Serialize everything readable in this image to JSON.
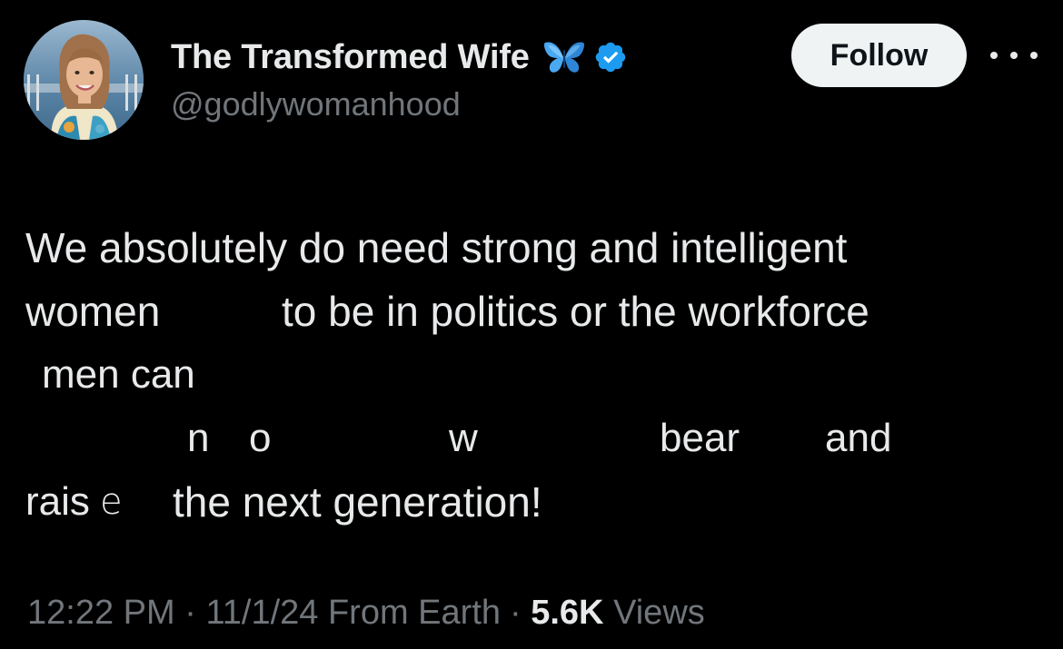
{
  "author": {
    "display_name": "The Transformed Wife",
    "handle": "@godlywomanhood",
    "badge_icon": "butterfly-icon",
    "verified_icon": "verified-badge-icon",
    "verified_color": "#1d9bf0"
  },
  "actions": {
    "follow_label": "Follow",
    "more_icon": "more-options-icon"
  },
  "tweet": {
    "line1": {
      "seg1": "We absolutely do need strong and intelligent"
    },
    "line2": {
      "seg1": "women",
      "seg2": "to be in politics or the workforce"
    },
    "line3": {
      "seg1": "men can"
    },
    "line4": {
      "seg1": "n",
      "seg2": "o",
      "seg3": "w",
      "seg4": "bear",
      "seg5": "and"
    },
    "line5": {
      "seg1": "rais",
      "seg2": "e",
      "seg3": "the next generation!"
    }
  },
  "meta": {
    "time": "12:22 PM",
    "date": "11/1/24",
    "source": "From Earth",
    "separator": "·",
    "views_count": "5.6K",
    "views_label": "Views"
  },
  "colors": {
    "background": "#000000",
    "text_primary": "#e7e9ea",
    "text_secondary": "#71767b",
    "follow_bg": "#eff3f4",
    "butterfly": "#4aa8f0"
  }
}
